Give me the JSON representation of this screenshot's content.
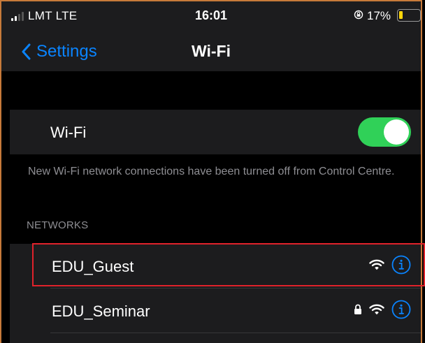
{
  "status_bar": {
    "carrier": "LMT  LTE",
    "time": "16:01",
    "battery_percent": "17%",
    "battery_level": 0.17,
    "signal_bars": 2,
    "icons": [
      "signal-icon",
      "rotation-lock-icon",
      "battery-icon"
    ]
  },
  "nav": {
    "back_label": "Settings",
    "title": "Wi-Fi"
  },
  "wifi_toggle": {
    "label": "Wi-Fi",
    "enabled": true,
    "on_color": "#30d158"
  },
  "note": "New Wi-Fi network connections have been turned off from Control Centre.",
  "networks": {
    "header": "NETWORKS",
    "items": [
      {
        "name": "EDU_Guest",
        "secured": false,
        "icons": [
          "wifi-icon",
          "info-icon"
        ]
      },
      {
        "name": "EDU_Seminar",
        "secured": true,
        "icons": [
          "lock-icon",
          "wifi-icon",
          "info-icon"
        ]
      }
    ]
  },
  "colors": {
    "accent": "#0a84ff",
    "highlight": "#e0222b"
  }
}
